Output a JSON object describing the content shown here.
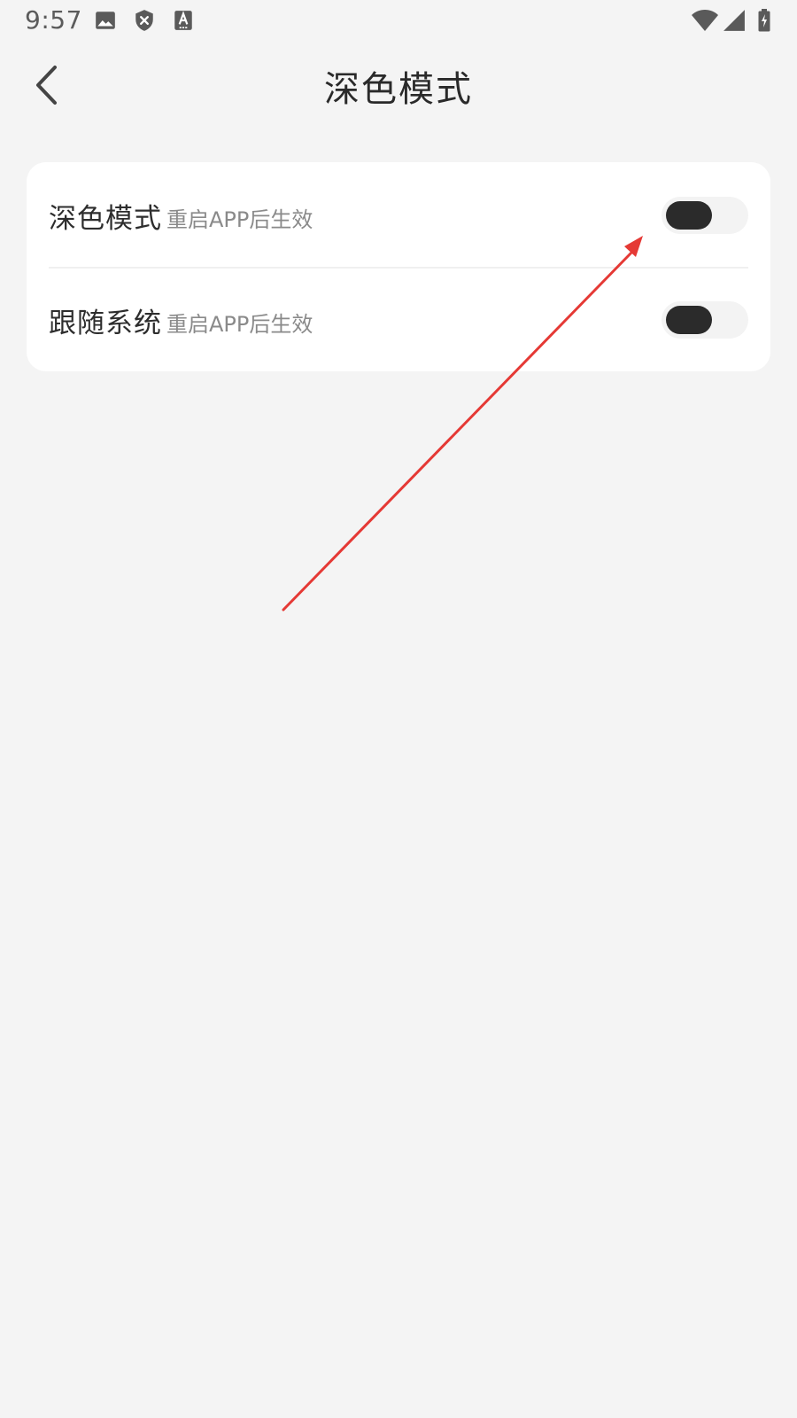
{
  "status_bar": {
    "time": "9:57",
    "icons": [
      "image-icon",
      "shield-x-icon",
      "text-a-icon",
      "wifi-icon",
      "signal-icon",
      "battery-icon"
    ]
  },
  "header": {
    "title": "深色模式",
    "back_icon": "chevron-left-icon"
  },
  "settings": [
    {
      "label": "深色模式",
      "hint": "重启APP后生效",
      "toggle_on": false
    },
    {
      "label": "跟随系统",
      "hint": "重启APP后生效",
      "toggle_on": false
    }
  ],
  "colors": {
    "background": "#f4f4f4",
    "card": "#ffffff",
    "toggle_track": "#f3f3f3",
    "toggle_knob": "#2b2b2b",
    "annotation_arrow": "#e53935"
  },
  "annotation": {
    "type": "arrow",
    "points_to": "dark-mode-toggle"
  }
}
